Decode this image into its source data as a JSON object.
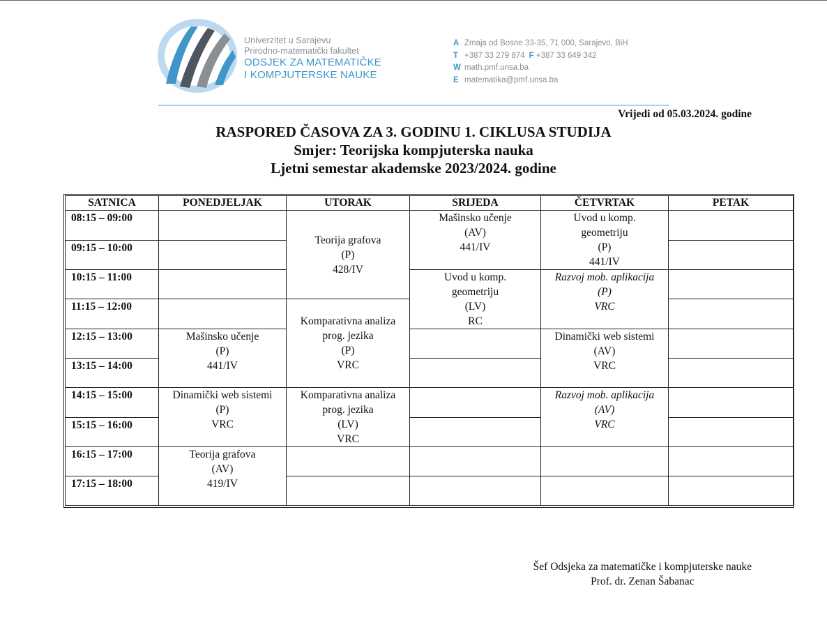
{
  "letterhead": {
    "university": "Univerzitet u Sarajevu",
    "faculty": "Prirodno-matematički fakultet",
    "department_line1": "ODSJEK ZA MATEMATIČKE",
    "department_line2": "I KOMPJUTERSKE NAUKE",
    "contact": {
      "address_key": "A",
      "address": "Zmaja od Bosne 33-35,  71 000, Sarajevo, BiH",
      "phone_key": "T",
      "phone": "+387 33 279 874",
      "fax_key": "F",
      "fax": "+387 33 649 342",
      "web_key": "W",
      "web": "math.pmf.unsa.ba",
      "email_key": "E",
      "email": "matematika@pmf.unsa.ba"
    },
    "colors": {
      "accent": "#3f96c9",
      "gray": "#8a8f95",
      "rule": "#a9d0ec"
    }
  },
  "valid_from": "Vrijedi od 05.03.2024. godine",
  "title": "RASPORED ČASOVA ZA 3. GODINU 1. CIKLUSA STUDIJA",
  "subtitle": "Smjer: Teorijska kompjuterska nauka",
  "semester": "Ljetni semestar akademske 2023/2024. godine",
  "table": {
    "headers": [
      "SATNICA",
      "PONEDJELJAK",
      "UTORAK",
      "SRIJEDA",
      "ČETVRTAK",
      "PETAK"
    ],
    "times": [
      "08:15 – 09:00",
      "09:15 – 10:00",
      "10:15 – 11:00",
      "11:15 – 12:00",
      "12:15 – 13:00",
      "13:15 – 14:00",
      "14:15 – 15:00",
      "15:15 – 16:00",
      "16:15 – 17:00",
      "17:15 – 18:00"
    ],
    "mon": {
      "masinsko": [
        "Mašinsko učenje",
        "(P)",
        "441/IV"
      ],
      "dinamicki": [
        "Dinamički web sistemi",
        "(P)",
        "VRC"
      ],
      "grafovi": [
        "Teorija grafova",
        "(AV)",
        "419/IV"
      ]
    },
    "tue": {
      "grafovi": [
        "Teorija grafova",
        "(P)",
        "428/IV"
      ],
      "komparativna_p": [
        "Komparativna analiza",
        "prog. jezika",
        "(P)",
        "VRC"
      ],
      "komparativna_lv": [
        "Komparativna analiza",
        "prog. jezika",
        "(LV)",
        "VRC"
      ]
    },
    "wed": {
      "masinsko": [
        "Mašinsko učenje",
        "(AV)",
        "441/IV"
      ],
      "uvod": [
        "Uvod u komp.",
        "geometriju",
        "(LV)",
        "RC"
      ]
    },
    "thu": {
      "uvod": [
        "Uvod u komp.",
        "geometriju",
        "(P)",
        "441/IV"
      ],
      "razvoj_p": [
        "Razvoj mob. aplikacija",
        "(P)",
        "VRC"
      ],
      "dinamicki": [
        "Dinamički web sistemi",
        "(AV)",
        "VRC"
      ],
      "razvoj_av": [
        "Razvoj mob. aplikacija",
        "(AV)",
        "VRC"
      ]
    }
  },
  "signature": {
    "line1": "Šef Odsjeka za matematičke i kompjuterske nauke",
    "line2": "Prof. dr. Zenan Šabanac"
  }
}
